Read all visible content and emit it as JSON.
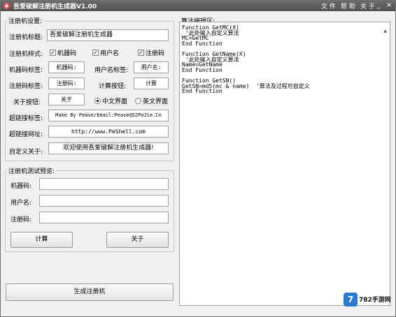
{
  "window": {
    "title": "吾爱破解注册机生成器V1.00",
    "menu": [
      "文 件",
      "帮 助",
      "关 于"
    ],
    "controls": {
      "minimize": "_",
      "close": "×"
    }
  },
  "settings": {
    "title": "注册机设置:",
    "keygen_title_label": "注册机标题:",
    "keygen_title_value": "吾爱破解注册机生成器",
    "style_label": "注册机样式:",
    "style_options": [
      {
        "label": "机器码",
        "checked": true
      },
      {
        "label": "用户名",
        "checked": true
      },
      {
        "label": "注册码",
        "checked": true
      }
    ],
    "machine_tag_label": "机器码标签:",
    "machine_tag_value": "机器码:",
    "user_tag_label": "用户名标签:",
    "user_tag_value": "用户名:",
    "reg_tag_label": "注册码标签:",
    "reg_tag_value": "注册码:",
    "calc_btn_label": "计算按钮:",
    "calc_btn_value": "计算",
    "about_btn_label": "关于按钮:",
    "about_btn_value": "关于",
    "lang_options": [
      {
        "label": "中文界面",
        "selected": true
      },
      {
        "label": "英文界面",
        "selected": false
      }
    ],
    "link_label_label": "超链接标签:",
    "link_label_value": "Make By Pease/Email:Pease@52PoJie.Cn",
    "link_url_label": "超链接网址:",
    "link_url_value": "http://www.PeShell.com",
    "custom_about_label": "自定义关于:",
    "custom_about_value": "欢迎使用吾爱破解注册机生成器!"
  },
  "preview": {
    "title": "注册机测试预览:",
    "machine_label": "机器码:",
    "user_label": "用户名:",
    "reg_label": "注册码:",
    "calc_button": "计算",
    "about_button": "关于"
  },
  "generate_button": "生成注册机",
  "editor": {
    "title": "算法编辑区:",
    "code": "Function GetMC(X)\n '此处输入自定义算法\nMC=GetMC\nEnd Function\n\nFunction GetName(X)\n '此处输入自定义算法\nName=GetName\nEnd Function\n\nFunction GetSN()\nGetSN=md5(mc & name)  '算法及过程可自定义\nEnd Function"
  },
  "watermark": {
    "mark": "7",
    "text": "782手游网"
  },
  "colors": {
    "titlebar": "#555555",
    "accent": "#2b7bd5"
  }
}
